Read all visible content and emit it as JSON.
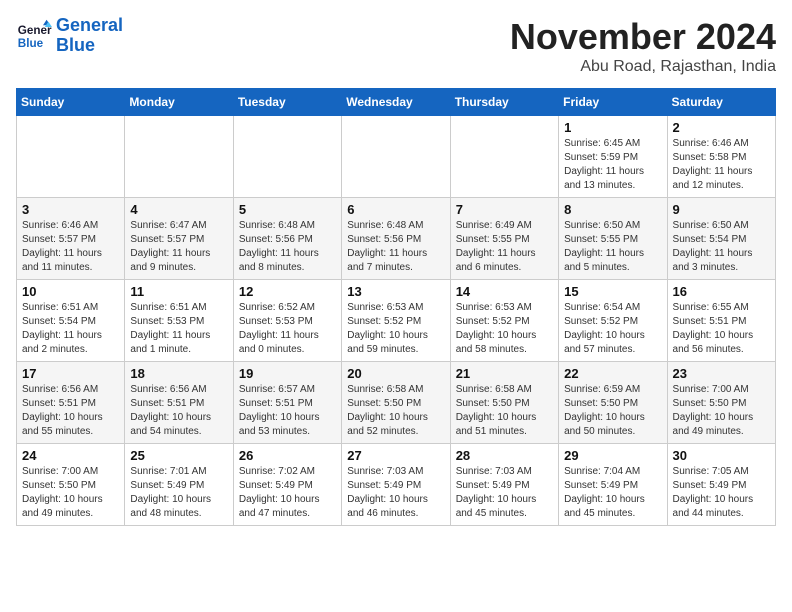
{
  "logo": {
    "line1": "General",
    "line2": "Blue"
  },
  "title": "November 2024",
  "location": "Abu Road, Rajasthan, India",
  "weekdays": [
    "Sunday",
    "Monday",
    "Tuesday",
    "Wednesday",
    "Thursday",
    "Friday",
    "Saturday"
  ],
  "weeks": [
    [
      {
        "day": "",
        "sunrise": "",
        "sunset": "",
        "daylight": ""
      },
      {
        "day": "",
        "sunrise": "",
        "sunset": "",
        "daylight": ""
      },
      {
        "day": "",
        "sunrise": "",
        "sunset": "",
        "daylight": ""
      },
      {
        "day": "",
        "sunrise": "",
        "sunset": "",
        "daylight": ""
      },
      {
        "day": "",
        "sunrise": "",
        "sunset": "",
        "daylight": ""
      },
      {
        "day": "1",
        "sunrise": "Sunrise: 6:45 AM",
        "sunset": "Sunset: 5:59 PM",
        "daylight": "Daylight: 11 hours and 13 minutes."
      },
      {
        "day": "2",
        "sunrise": "Sunrise: 6:46 AM",
        "sunset": "Sunset: 5:58 PM",
        "daylight": "Daylight: 11 hours and 12 minutes."
      }
    ],
    [
      {
        "day": "3",
        "sunrise": "Sunrise: 6:46 AM",
        "sunset": "Sunset: 5:57 PM",
        "daylight": "Daylight: 11 hours and 11 minutes."
      },
      {
        "day": "4",
        "sunrise": "Sunrise: 6:47 AM",
        "sunset": "Sunset: 5:57 PM",
        "daylight": "Daylight: 11 hours and 9 minutes."
      },
      {
        "day": "5",
        "sunrise": "Sunrise: 6:48 AM",
        "sunset": "Sunset: 5:56 PM",
        "daylight": "Daylight: 11 hours and 8 minutes."
      },
      {
        "day": "6",
        "sunrise": "Sunrise: 6:48 AM",
        "sunset": "Sunset: 5:56 PM",
        "daylight": "Daylight: 11 hours and 7 minutes."
      },
      {
        "day": "7",
        "sunrise": "Sunrise: 6:49 AM",
        "sunset": "Sunset: 5:55 PM",
        "daylight": "Daylight: 11 hours and 6 minutes."
      },
      {
        "day": "8",
        "sunrise": "Sunrise: 6:50 AM",
        "sunset": "Sunset: 5:55 PM",
        "daylight": "Daylight: 11 hours and 5 minutes."
      },
      {
        "day": "9",
        "sunrise": "Sunrise: 6:50 AM",
        "sunset": "Sunset: 5:54 PM",
        "daylight": "Daylight: 11 hours and 3 minutes."
      }
    ],
    [
      {
        "day": "10",
        "sunrise": "Sunrise: 6:51 AM",
        "sunset": "Sunset: 5:54 PM",
        "daylight": "Daylight: 11 hours and 2 minutes."
      },
      {
        "day": "11",
        "sunrise": "Sunrise: 6:51 AM",
        "sunset": "Sunset: 5:53 PM",
        "daylight": "Daylight: 11 hours and 1 minute."
      },
      {
        "day": "12",
        "sunrise": "Sunrise: 6:52 AM",
        "sunset": "Sunset: 5:53 PM",
        "daylight": "Daylight: 11 hours and 0 minutes."
      },
      {
        "day": "13",
        "sunrise": "Sunrise: 6:53 AM",
        "sunset": "Sunset: 5:52 PM",
        "daylight": "Daylight: 10 hours and 59 minutes."
      },
      {
        "day": "14",
        "sunrise": "Sunrise: 6:53 AM",
        "sunset": "Sunset: 5:52 PM",
        "daylight": "Daylight: 10 hours and 58 minutes."
      },
      {
        "day": "15",
        "sunrise": "Sunrise: 6:54 AM",
        "sunset": "Sunset: 5:52 PM",
        "daylight": "Daylight: 10 hours and 57 minutes."
      },
      {
        "day": "16",
        "sunrise": "Sunrise: 6:55 AM",
        "sunset": "Sunset: 5:51 PM",
        "daylight": "Daylight: 10 hours and 56 minutes."
      }
    ],
    [
      {
        "day": "17",
        "sunrise": "Sunrise: 6:56 AM",
        "sunset": "Sunset: 5:51 PM",
        "daylight": "Daylight: 10 hours and 55 minutes."
      },
      {
        "day": "18",
        "sunrise": "Sunrise: 6:56 AM",
        "sunset": "Sunset: 5:51 PM",
        "daylight": "Daylight: 10 hours and 54 minutes."
      },
      {
        "day": "19",
        "sunrise": "Sunrise: 6:57 AM",
        "sunset": "Sunset: 5:51 PM",
        "daylight": "Daylight: 10 hours and 53 minutes."
      },
      {
        "day": "20",
        "sunrise": "Sunrise: 6:58 AM",
        "sunset": "Sunset: 5:50 PM",
        "daylight": "Daylight: 10 hours and 52 minutes."
      },
      {
        "day": "21",
        "sunrise": "Sunrise: 6:58 AM",
        "sunset": "Sunset: 5:50 PM",
        "daylight": "Daylight: 10 hours and 51 minutes."
      },
      {
        "day": "22",
        "sunrise": "Sunrise: 6:59 AM",
        "sunset": "Sunset: 5:50 PM",
        "daylight": "Daylight: 10 hours and 50 minutes."
      },
      {
        "day": "23",
        "sunrise": "Sunrise: 7:00 AM",
        "sunset": "Sunset: 5:50 PM",
        "daylight": "Daylight: 10 hours and 49 minutes."
      }
    ],
    [
      {
        "day": "24",
        "sunrise": "Sunrise: 7:00 AM",
        "sunset": "Sunset: 5:50 PM",
        "daylight": "Daylight: 10 hours and 49 minutes."
      },
      {
        "day": "25",
        "sunrise": "Sunrise: 7:01 AM",
        "sunset": "Sunset: 5:49 PM",
        "daylight": "Daylight: 10 hours and 48 minutes."
      },
      {
        "day": "26",
        "sunrise": "Sunrise: 7:02 AM",
        "sunset": "Sunset: 5:49 PM",
        "daylight": "Daylight: 10 hours and 47 minutes."
      },
      {
        "day": "27",
        "sunrise": "Sunrise: 7:03 AM",
        "sunset": "Sunset: 5:49 PM",
        "daylight": "Daylight: 10 hours and 46 minutes."
      },
      {
        "day": "28",
        "sunrise": "Sunrise: 7:03 AM",
        "sunset": "Sunset: 5:49 PM",
        "daylight": "Daylight: 10 hours and 45 minutes."
      },
      {
        "day": "29",
        "sunrise": "Sunrise: 7:04 AM",
        "sunset": "Sunset: 5:49 PM",
        "daylight": "Daylight: 10 hours and 45 minutes."
      },
      {
        "day": "30",
        "sunrise": "Sunrise: 7:05 AM",
        "sunset": "Sunset: 5:49 PM",
        "daylight": "Daylight: 10 hours and 44 minutes."
      }
    ]
  ]
}
